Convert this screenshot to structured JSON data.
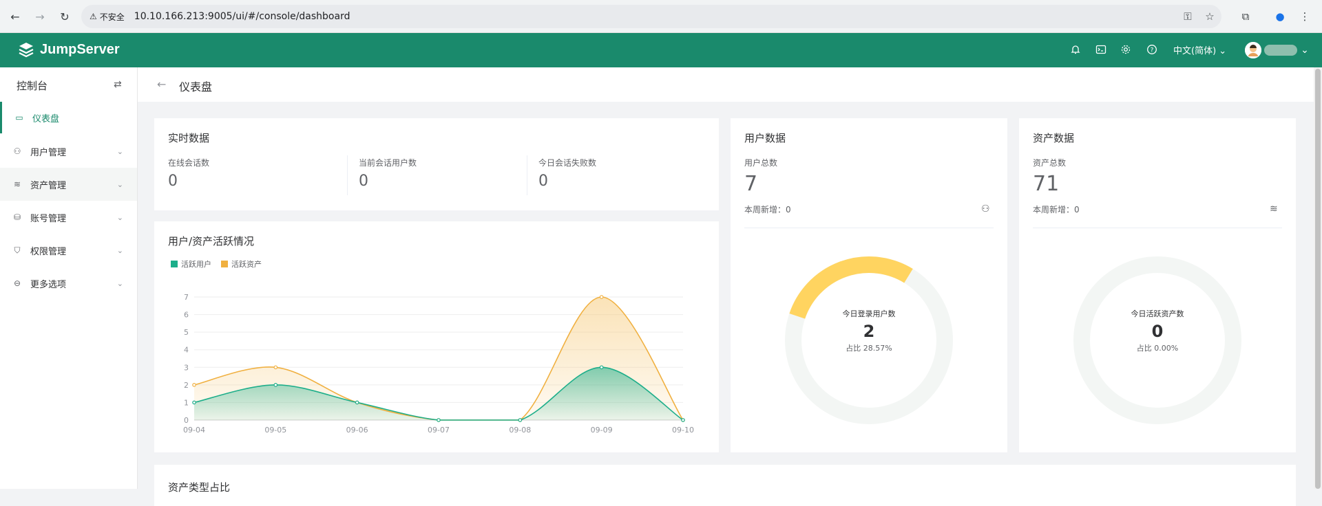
{
  "browser": {
    "security_label": "不安全",
    "url": "10.10.166.213:9005/ui/#/console/dashboard"
  },
  "header": {
    "brand": "JumpServer",
    "language": "中文(简体)"
  },
  "sidebar": {
    "title": "控制台",
    "items": [
      {
        "label": "仪表盘",
        "icon": "dashboard-icon"
      },
      {
        "label": "用户管理",
        "icon": "users-icon"
      },
      {
        "label": "资产管理",
        "icon": "layers-icon"
      },
      {
        "label": "账号管理",
        "icon": "account-icon"
      },
      {
        "label": "权限管理",
        "icon": "shield-icon"
      },
      {
        "label": "更多选项",
        "icon": "more-icon"
      }
    ]
  },
  "page": {
    "title": "仪表盘"
  },
  "realtime": {
    "title": "实时数据",
    "stats": [
      {
        "label": "在线会话数",
        "value": "0"
      },
      {
        "label": "当前会话用户数",
        "value": "0"
      },
      {
        "label": "今日会话失败数",
        "value": "0"
      }
    ]
  },
  "users": {
    "title": "用户数据",
    "total_label": "用户总数",
    "total": "7",
    "weekly_label": "本周新增：",
    "weekly": "0",
    "donut_label": "今日登录用户数",
    "donut_value": "2",
    "donut_pct": "占比 28.57%",
    "donut_fraction": 0.2857
  },
  "assets": {
    "title": "资产数据",
    "total_label": "资产总数",
    "total": "71",
    "weekly_label": "本周新增：",
    "weekly": "0",
    "donut_label": "今日活跃资产数",
    "donut_value": "0",
    "donut_pct": "占比 0.00%",
    "donut_fraction": 0
  },
  "activity": {
    "title": "用户/资产活跃情况",
    "legend": [
      "活跃用户",
      "活跃资产"
    ]
  },
  "bottom": {
    "title": "资产类型占比"
  },
  "colors": {
    "brand": "#1a8a6c",
    "user_series": "#1cae8a",
    "asset_series": "#f0b040",
    "donut_users": "#ffd460",
    "donut_track": "#f3f6f4"
  },
  "chart_data": {
    "type": "area",
    "categories": [
      "09-04",
      "09-05",
      "09-06",
      "09-07",
      "09-08",
      "09-09",
      "09-10"
    ],
    "series": [
      {
        "name": "活跃用户",
        "values": [
          1,
          2,
          1,
          0,
          0,
          3,
          0
        ]
      },
      {
        "name": "活跃资产",
        "values": [
          2,
          3,
          1,
          0,
          0,
          7,
          0
        ]
      }
    ],
    "yticks": [
      0,
      1,
      2,
      3,
      4,
      5,
      6,
      7
    ],
    "ylim": [
      0,
      7
    ],
    "grid": true,
    "legend": "top-left"
  }
}
